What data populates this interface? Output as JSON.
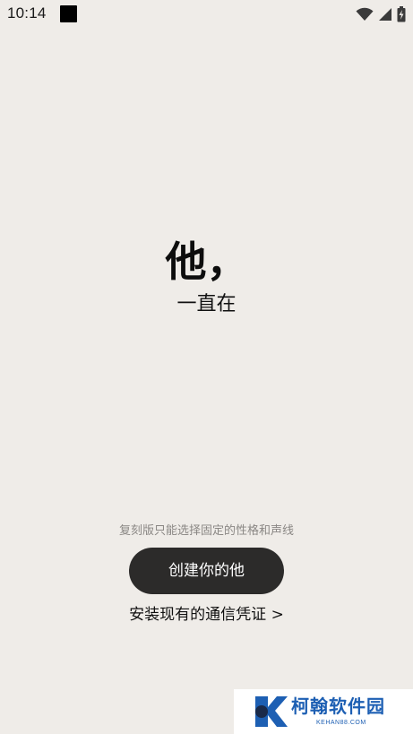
{
  "status_bar": {
    "time": "10:14",
    "icons": [
      "app-notification-icon",
      "wifi-icon",
      "signal-icon",
      "battery-icon"
    ]
  },
  "hero": {
    "title": "他，",
    "subtitle": "一直在"
  },
  "footer": {
    "hint": "复刻版只能选择固定的性格和声线",
    "create_button_label": "创建你的他",
    "import_link_label": "安装现有的通信凭证 >"
  },
  "watermark": {
    "name": "柯翰软件园",
    "domain": "KEHAN88.COM"
  },
  "colors": {
    "background": "#efece8",
    "button_bg": "#2c2b2a",
    "button_text": "#ffffff",
    "hint_text": "#8a8784",
    "watermark_blue": "#1d5fb3"
  }
}
